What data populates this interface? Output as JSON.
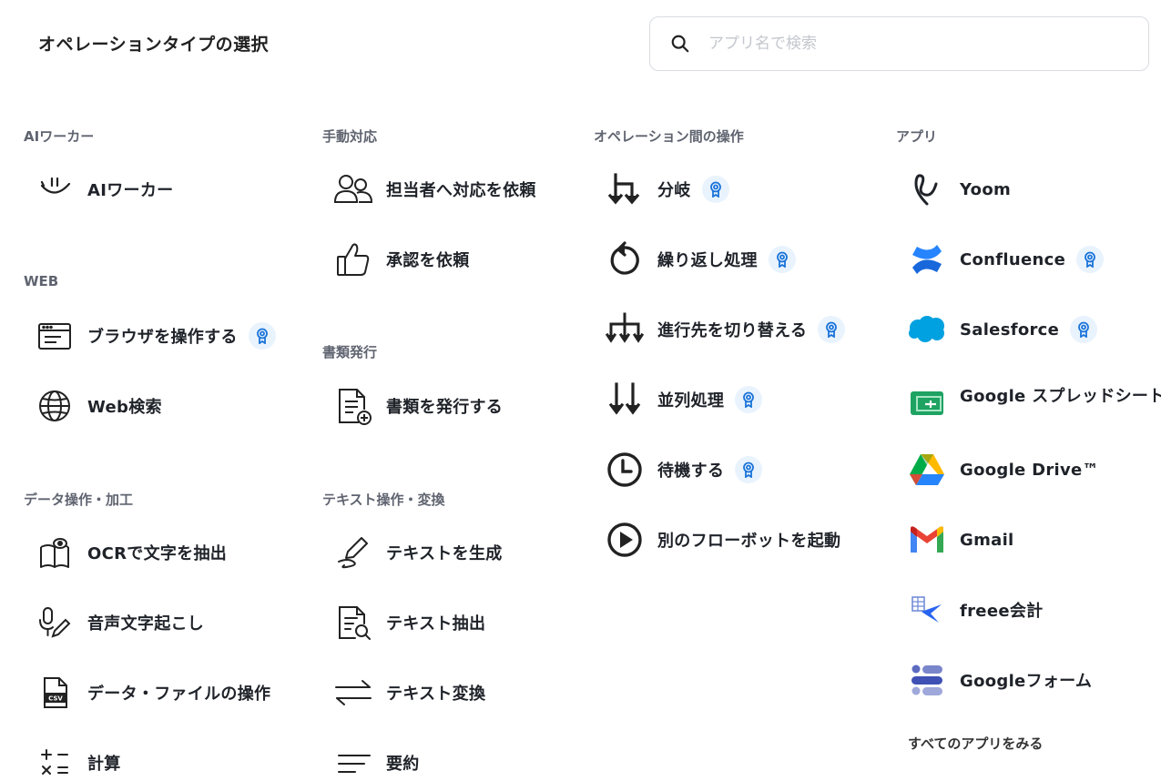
{
  "header": {
    "title": "オペレーションタイプの選択",
    "search_placeholder": "アプリ名で検索"
  },
  "columns": {
    "ai": {
      "title": "AIワーカー",
      "items": [
        {
          "label": "AIワーカー",
          "icon": "ai-worker-icon"
        }
      ]
    },
    "web": {
      "title": "WEB",
      "items": [
        {
          "label": "ブラウザを操作する",
          "icon": "browser-icon",
          "premium": true
        },
        {
          "label": "Web検索",
          "icon": "globe-icon"
        }
      ]
    },
    "data": {
      "title": "データ操作・加工",
      "items": [
        {
          "label": "OCRで文字を抽出",
          "icon": "ocr-book-icon"
        },
        {
          "label": "音声文字起こし",
          "icon": "microphone-pen-icon"
        },
        {
          "label": "データ・ファイルの操作",
          "icon": "csv-file-icon"
        },
        {
          "label": "計算",
          "icon": "calculator-icon"
        }
      ]
    },
    "manual": {
      "title": "手動対応",
      "items": [
        {
          "label": "担当者へ対応を依頼",
          "icon": "people-icon"
        },
        {
          "label": "承認を依頼",
          "icon": "thumbs-up-icon"
        }
      ]
    },
    "docs": {
      "title": "書類発行",
      "items": [
        {
          "label": "書類を発行する",
          "icon": "document-add-icon"
        }
      ]
    },
    "text": {
      "title": "テキスト操作・変換",
      "items": [
        {
          "label": "テキストを生成",
          "icon": "pen-icon"
        },
        {
          "label": "テキスト抽出",
          "icon": "document-search-icon"
        },
        {
          "label": "テキスト変換",
          "icon": "swap-arrows-icon"
        },
        {
          "label": "要約",
          "icon": "summary-lines-icon"
        }
      ]
    },
    "ops": {
      "title": "オペレーション間の操作",
      "items": [
        {
          "label": "分岐",
          "icon": "branch-icon",
          "premium": true
        },
        {
          "label": "繰り返し処理",
          "icon": "loop-icon",
          "premium": true
        },
        {
          "label": "進行先を切り替える",
          "icon": "switch-route-icon",
          "premium": true
        },
        {
          "label": "並列処理",
          "icon": "parallel-icon",
          "premium": true
        },
        {
          "label": "待機する",
          "icon": "clock-icon",
          "premium": true
        },
        {
          "label": "別のフローボットを起動",
          "icon": "play-icon"
        }
      ]
    },
    "apps": {
      "title": "アプリ",
      "items": [
        {
          "label": "Yoom",
          "icon": "yoom-logo-icon"
        },
        {
          "label": "Confluence",
          "icon": "confluence-logo-icon",
          "premium": true
        },
        {
          "label": "Salesforce",
          "icon": "salesforce-logo-icon",
          "premium": true
        },
        {
          "label": "Google スプレッドシート",
          "icon": "google-sheets-logo-icon"
        },
        {
          "label": "Google Drive™",
          "icon": "google-drive-logo-icon"
        },
        {
          "label": "Gmail",
          "icon": "gmail-logo-icon"
        },
        {
          "label": "freee会計",
          "icon": "freee-logo-icon"
        },
        {
          "label": "Googleフォーム",
          "icon": "google-forms-logo-icon"
        }
      ],
      "see_all": "すべてのアプリをみる"
    }
  },
  "colors": {
    "badge_bg": "#e9f3fd",
    "badge_icon": "#1a73d9",
    "section_title": "#5f6470"
  }
}
